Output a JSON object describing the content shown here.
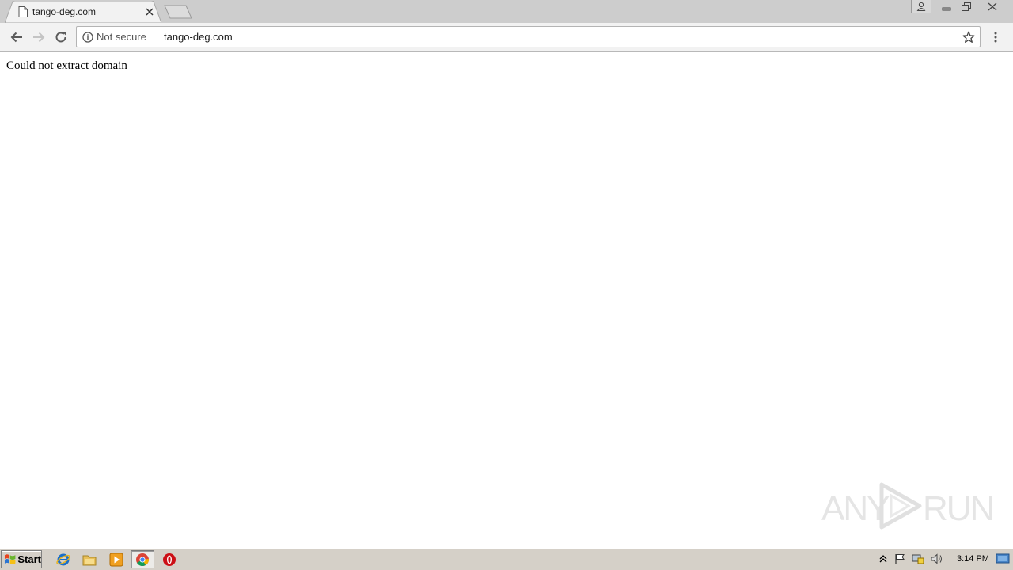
{
  "browser": {
    "tab": {
      "title": "tango-deg.com"
    },
    "address_bar": {
      "security_label": "Not secure",
      "url": "tango-deg.com"
    }
  },
  "page": {
    "body_text": "Could not extract domain"
  },
  "taskbar": {
    "start_label": "Start",
    "clock": "3:14 PM",
    "pinned_icons": [
      "internet-explorer-icon",
      "file-explorer-icon",
      "media-player-icon",
      "chrome-icon",
      "opera-icon"
    ],
    "tray_icons": [
      "show-hidden-icons-icon",
      "action-center-flag-icon",
      "network-icon",
      "volume-icon"
    ]
  },
  "colors": {
    "tab_strip": "#cdcdcd",
    "toolbar": "#f2f2f2",
    "taskbar": "#d5d0c8",
    "opera_red": "#cc0f16",
    "ie_blue": "#1a6fc9"
  }
}
